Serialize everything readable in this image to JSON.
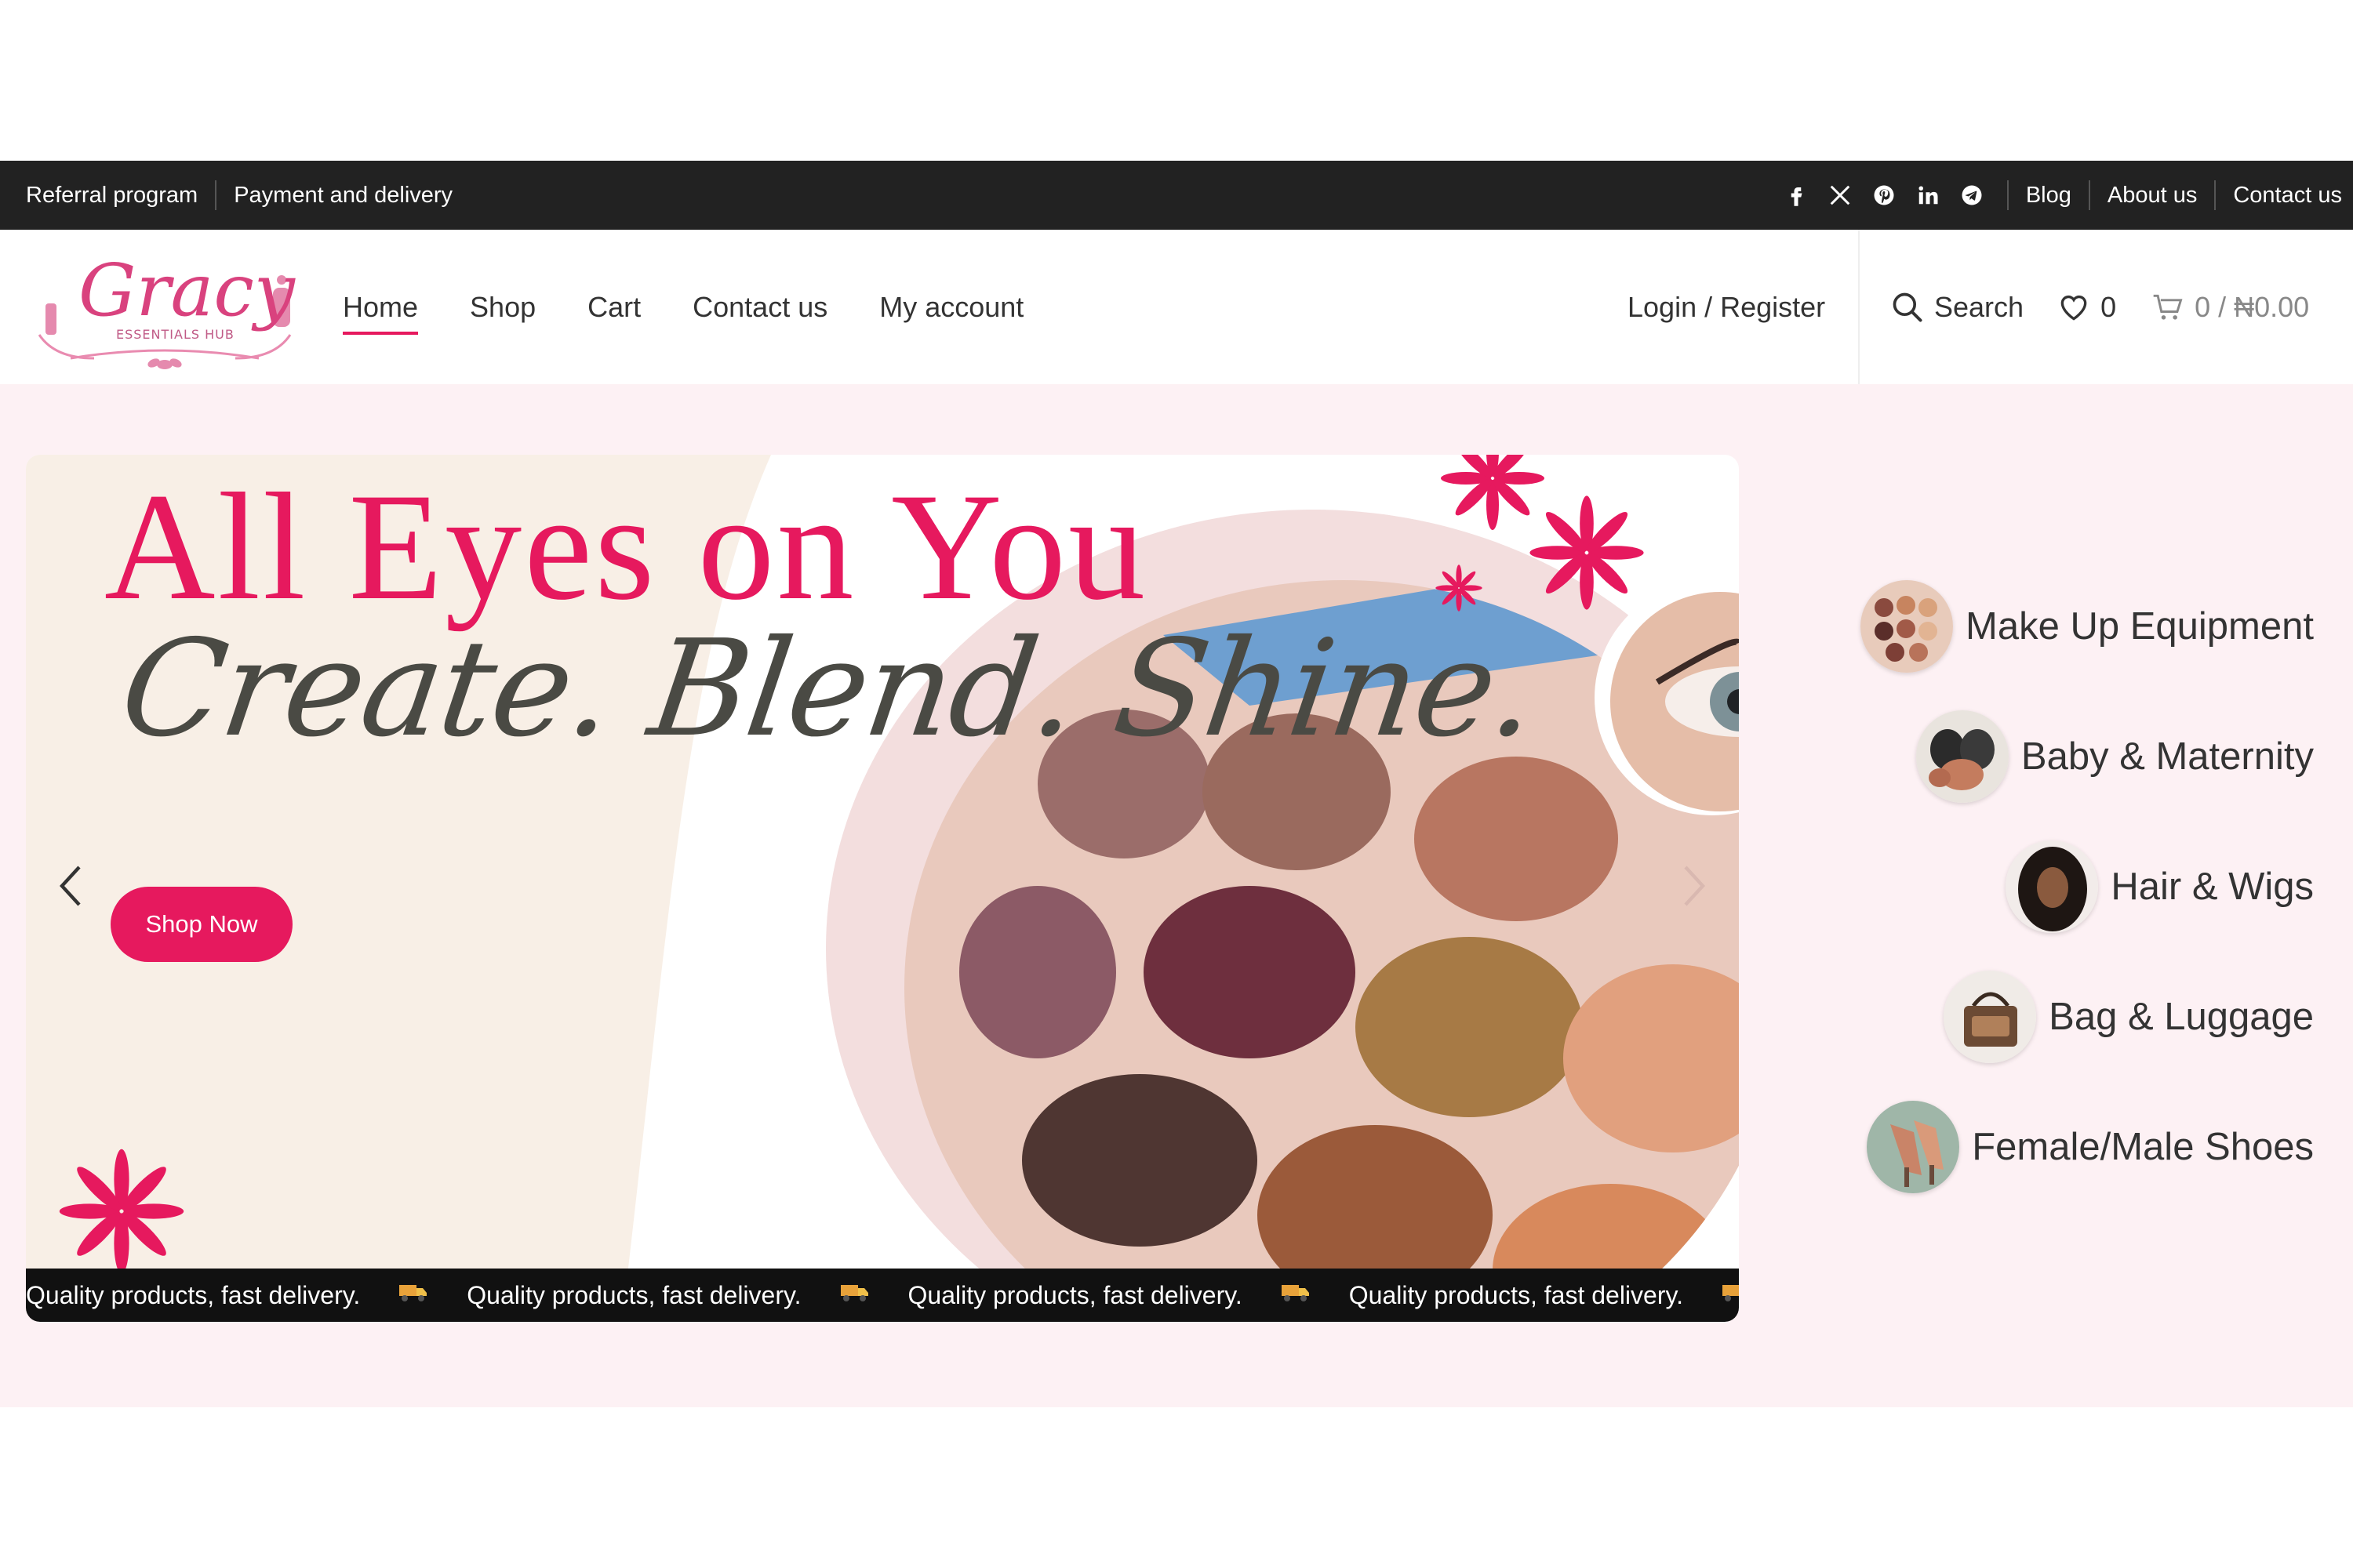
{
  "topbar": {
    "left_links": [
      "Referral program",
      "Payment and delivery"
    ],
    "social_icons": [
      "facebook-icon",
      "x-icon",
      "pinterest-icon",
      "linkedin-icon",
      "telegram-icon"
    ],
    "right_links": [
      "Blog",
      "About us",
      "Contact us"
    ]
  },
  "header": {
    "logo": {
      "name": "Gracy",
      "subtitle": "ESSENTIALS HUB"
    },
    "nav": [
      "Home",
      "Shop",
      "Cart",
      "Contact us",
      "My account"
    ],
    "active_nav": "Home",
    "login": "Login / Register",
    "search_label": "Search",
    "wishlist_count": "0",
    "cart_summary": "0 / ₦0.00"
  },
  "hero": {
    "headline": "All Eyes on You",
    "tagline": "Create. Blend. Shine.",
    "cta": "Shop Now",
    "ticker_text": "Quality products, fast delivery.",
    "ticker_repeat": 4
  },
  "categories": [
    {
      "label": "Make Up Equipment"
    },
    {
      "label": "Baby & Maternity"
    },
    {
      "label": "Hair & Wigs"
    },
    {
      "label": "Bag & Luggage"
    },
    {
      "label": "Female/Male Shoes"
    }
  ],
  "colors": {
    "accent": "#e6195e",
    "topbar": "#222222",
    "hero_bg": "#fdf1f4"
  }
}
